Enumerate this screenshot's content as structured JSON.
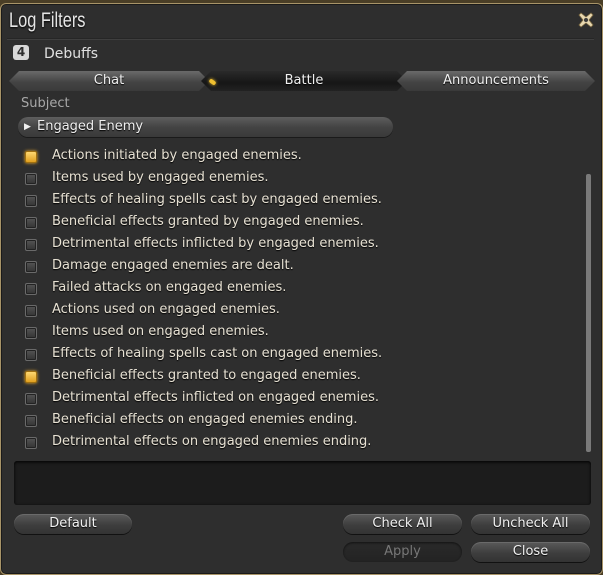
{
  "window": {
    "title": "Log Filters",
    "close_label": "Close window"
  },
  "preset": {
    "number": "4",
    "name": "Debuffs"
  },
  "tabs": [
    {
      "label": "Chat",
      "active": false
    },
    {
      "label": "Battle",
      "active": true
    },
    {
      "label": "Announcements",
      "active": false
    }
  ],
  "subject": {
    "label": "Subject",
    "selected": "Engaged Enemy",
    "arrow": "▶"
  },
  "filters": [
    {
      "label": "Actions initiated by engaged enemies.",
      "checked": true
    },
    {
      "label": "Items used by engaged enemies.",
      "checked": false
    },
    {
      "label": "Effects of healing spells cast by engaged enemies.",
      "checked": false
    },
    {
      "label": "Beneficial effects granted by engaged enemies.",
      "checked": false
    },
    {
      "label": "Detrimental effects inflicted by engaged enemies.",
      "checked": false
    },
    {
      "label": "Damage engaged enemies are dealt.",
      "checked": false
    },
    {
      "label": "Failed attacks on engaged enemies.",
      "checked": false
    },
    {
      "label": "Actions used on engaged enemies.",
      "checked": false
    },
    {
      "label": "Items used on engaged enemies.",
      "checked": false
    },
    {
      "label": "Effects of healing spells cast on engaged enemies.",
      "checked": false
    },
    {
      "label": "Beneficial effects granted to engaged enemies.",
      "checked": true
    },
    {
      "label": "Detrimental effects inflicted on engaged enemies.",
      "checked": false
    },
    {
      "label": "Beneficial effects on engaged enemies ending.",
      "checked": false
    },
    {
      "label": "Detrimental effects on engaged enemies ending.",
      "checked": false
    }
  ],
  "description": "",
  "buttons": {
    "default": "Default",
    "check_all": "Check All",
    "uncheck_all": "Uncheck All",
    "apply": "Apply",
    "close": "Close"
  },
  "colors": {
    "accent_checked": "#f0b030",
    "frame_gold": "#a89468"
  }
}
